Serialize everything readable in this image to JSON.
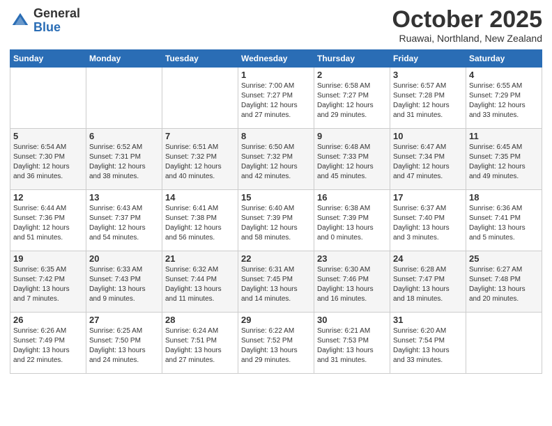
{
  "header": {
    "logo_general": "General",
    "logo_blue": "Blue",
    "month_title": "October 2025",
    "location": "Ruawai, Northland, New Zealand"
  },
  "days_of_week": [
    "Sunday",
    "Monday",
    "Tuesday",
    "Wednesday",
    "Thursday",
    "Friday",
    "Saturday"
  ],
  "weeks": [
    [
      {
        "day": "",
        "detail": ""
      },
      {
        "day": "",
        "detail": ""
      },
      {
        "day": "",
        "detail": ""
      },
      {
        "day": "1",
        "detail": "Sunrise: 7:00 AM\nSunset: 7:27 PM\nDaylight: 12 hours\nand 27 minutes."
      },
      {
        "day": "2",
        "detail": "Sunrise: 6:58 AM\nSunset: 7:27 PM\nDaylight: 12 hours\nand 29 minutes."
      },
      {
        "day": "3",
        "detail": "Sunrise: 6:57 AM\nSunset: 7:28 PM\nDaylight: 12 hours\nand 31 minutes."
      },
      {
        "day": "4",
        "detail": "Sunrise: 6:55 AM\nSunset: 7:29 PM\nDaylight: 12 hours\nand 33 minutes."
      }
    ],
    [
      {
        "day": "5",
        "detail": "Sunrise: 6:54 AM\nSunset: 7:30 PM\nDaylight: 12 hours\nand 36 minutes."
      },
      {
        "day": "6",
        "detail": "Sunrise: 6:52 AM\nSunset: 7:31 PM\nDaylight: 12 hours\nand 38 minutes."
      },
      {
        "day": "7",
        "detail": "Sunrise: 6:51 AM\nSunset: 7:32 PM\nDaylight: 12 hours\nand 40 minutes."
      },
      {
        "day": "8",
        "detail": "Sunrise: 6:50 AM\nSunset: 7:32 PM\nDaylight: 12 hours\nand 42 minutes."
      },
      {
        "day": "9",
        "detail": "Sunrise: 6:48 AM\nSunset: 7:33 PM\nDaylight: 12 hours\nand 45 minutes."
      },
      {
        "day": "10",
        "detail": "Sunrise: 6:47 AM\nSunset: 7:34 PM\nDaylight: 12 hours\nand 47 minutes."
      },
      {
        "day": "11",
        "detail": "Sunrise: 6:45 AM\nSunset: 7:35 PM\nDaylight: 12 hours\nand 49 minutes."
      }
    ],
    [
      {
        "day": "12",
        "detail": "Sunrise: 6:44 AM\nSunset: 7:36 PM\nDaylight: 12 hours\nand 51 minutes."
      },
      {
        "day": "13",
        "detail": "Sunrise: 6:43 AM\nSunset: 7:37 PM\nDaylight: 12 hours\nand 54 minutes."
      },
      {
        "day": "14",
        "detail": "Sunrise: 6:41 AM\nSunset: 7:38 PM\nDaylight: 12 hours\nand 56 minutes."
      },
      {
        "day": "15",
        "detail": "Sunrise: 6:40 AM\nSunset: 7:39 PM\nDaylight: 12 hours\nand 58 minutes."
      },
      {
        "day": "16",
        "detail": "Sunrise: 6:38 AM\nSunset: 7:39 PM\nDaylight: 13 hours\nand 0 minutes."
      },
      {
        "day": "17",
        "detail": "Sunrise: 6:37 AM\nSunset: 7:40 PM\nDaylight: 13 hours\nand 3 minutes."
      },
      {
        "day": "18",
        "detail": "Sunrise: 6:36 AM\nSunset: 7:41 PM\nDaylight: 13 hours\nand 5 minutes."
      }
    ],
    [
      {
        "day": "19",
        "detail": "Sunrise: 6:35 AM\nSunset: 7:42 PM\nDaylight: 13 hours\nand 7 minutes."
      },
      {
        "day": "20",
        "detail": "Sunrise: 6:33 AM\nSunset: 7:43 PM\nDaylight: 13 hours\nand 9 minutes."
      },
      {
        "day": "21",
        "detail": "Sunrise: 6:32 AM\nSunset: 7:44 PM\nDaylight: 13 hours\nand 11 minutes."
      },
      {
        "day": "22",
        "detail": "Sunrise: 6:31 AM\nSunset: 7:45 PM\nDaylight: 13 hours\nand 14 minutes."
      },
      {
        "day": "23",
        "detail": "Sunrise: 6:30 AM\nSunset: 7:46 PM\nDaylight: 13 hours\nand 16 minutes."
      },
      {
        "day": "24",
        "detail": "Sunrise: 6:28 AM\nSunset: 7:47 PM\nDaylight: 13 hours\nand 18 minutes."
      },
      {
        "day": "25",
        "detail": "Sunrise: 6:27 AM\nSunset: 7:48 PM\nDaylight: 13 hours\nand 20 minutes."
      }
    ],
    [
      {
        "day": "26",
        "detail": "Sunrise: 6:26 AM\nSunset: 7:49 PM\nDaylight: 13 hours\nand 22 minutes."
      },
      {
        "day": "27",
        "detail": "Sunrise: 6:25 AM\nSunset: 7:50 PM\nDaylight: 13 hours\nand 24 minutes."
      },
      {
        "day": "28",
        "detail": "Sunrise: 6:24 AM\nSunset: 7:51 PM\nDaylight: 13 hours\nand 27 minutes."
      },
      {
        "day": "29",
        "detail": "Sunrise: 6:22 AM\nSunset: 7:52 PM\nDaylight: 13 hours\nand 29 minutes."
      },
      {
        "day": "30",
        "detail": "Sunrise: 6:21 AM\nSunset: 7:53 PM\nDaylight: 13 hours\nand 31 minutes."
      },
      {
        "day": "31",
        "detail": "Sunrise: 6:20 AM\nSunset: 7:54 PM\nDaylight: 13 hours\nand 33 minutes."
      },
      {
        "day": "",
        "detail": ""
      }
    ]
  ]
}
